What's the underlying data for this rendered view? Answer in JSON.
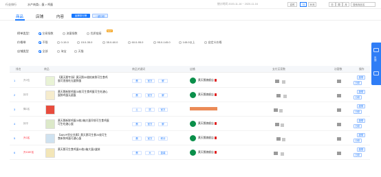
{
  "topbar": {
    "breadcrumb_root": "行业排行",
    "breadcrumb_path": "水产肉类/...蛋 > 鸡蛋",
    "date_range": "统计时间 2020-11-16 ~ 2020-11-16",
    "realtime": "实时",
    "d7": "7天",
    "d30": "30天",
    "day": "日",
    "week": "周",
    "month": "月",
    "search_placeholder": "搜索商品名"
  },
  "tabs": {
    "product": "商品",
    "shop": "店铺",
    "content": "内容",
    "export_btn": "品牌排行榜",
    "help_btn": "一键分析"
  },
  "filters": {
    "rank_label": "榜单类型：",
    "rank_options": [
      "交易指数",
      "流量指数",
      "优质链接"
    ],
    "new_tag": "NEW",
    "price_label": "价格带",
    "price_options": [
      "不限",
      "0-15.0",
      "15.0-35.0",
      "35.0-60.0",
      "60.0-95.0",
      "95.0-145.0",
      "145.0以上",
      "自定义价格"
    ],
    "shop_label": "店铺类型",
    "shop_options": [
      "全部",
      "淘宝",
      "天猫"
    ]
  },
  "table": {
    "headers": [
      "排名",
      "商品",
      "商品关键词",
      "店铺",
      "支付买家数",
      "访客数",
      "操作"
    ],
    "rows": [
      {
        "rank": "1",
        "change": "升2位",
        "change_red": false,
        "title": "【黄天鹅专场】黄天鹅30枚柏来鲜可生食鸡蛋可直接吃无菌鲜蛋",
        "keywords": [
          "蛋",
          "官方",
          "鲜"
        ],
        "shop": "黄天鹅旗舰店",
        "actions": [
          "趋势",
          "分析"
        ]
      },
      {
        "rank": "2",
        "change": "持平",
        "change_red": false,
        "title": "黄天鹅新鲜鸡蛋30枚可生食鸡蛋可生吃溏心蛋鲜鸡蛋无菌蛋",
        "keywords": [
          "蛋",
          "官方",
          "鲜"
        ],
        "shop": "黄天鹅旗舰店",
        "actions": [
          "趋势",
          "分析"
        ]
      },
      {
        "rank": "3",
        "change": "降2名",
        "change_red": false,
        "title": "",
        "keywords": [
          "土",
          "抗",
          "官方"
        ],
        "shop": "",
        "actions": [
          "趋势",
          "分析"
        ]
      },
      {
        "rank": "4",
        "change": "持平",
        "change_red": false,
        "title": "黄天鹅新鲜鸡蛋30枚2箱大蛋早餐可生食鸡蛋可生吃溏心蛋",
        "keywords": [
          "蛋",
          "官方",
          "鲜"
        ],
        "shop": "黄天鹅旗舰店",
        "actions": [
          "趋势",
          "分析"
        ]
      },
      {
        "rank": "5",
        "change": "升2名",
        "change_red": true,
        "title": "【88VIP积分兑换】黄天鹅可生食20枚可生食新鲜鸡蛋可溏心蛋",
        "keywords": [
          "蛋",
          "官方",
          "积分"
        ],
        "shop": "黄天鹅旗舰店",
        "actions": [
          "趋势",
          "分析"
        ]
      },
      {
        "rank": "6",
        "change": "升1087名",
        "change_red": true,
        "title": "黄天鹅可生食鸡蛋30枚1箱大蛋2盒装",
        "keywords": [
          "蛋",
          "大",
          "盒装"
        ],
        "shop": "黄天鹅旗舰店",
        "actions": [
          "趋势",
          "分析"
        ]
      }
    ]
  },
  "float_panel": {
    "label": "反馈"
  },
  "colors": {
    "accent": "#1677ff",
    "shop_logo": "#0a8f4a",
    "float": "#2f7df6"
  }
}
